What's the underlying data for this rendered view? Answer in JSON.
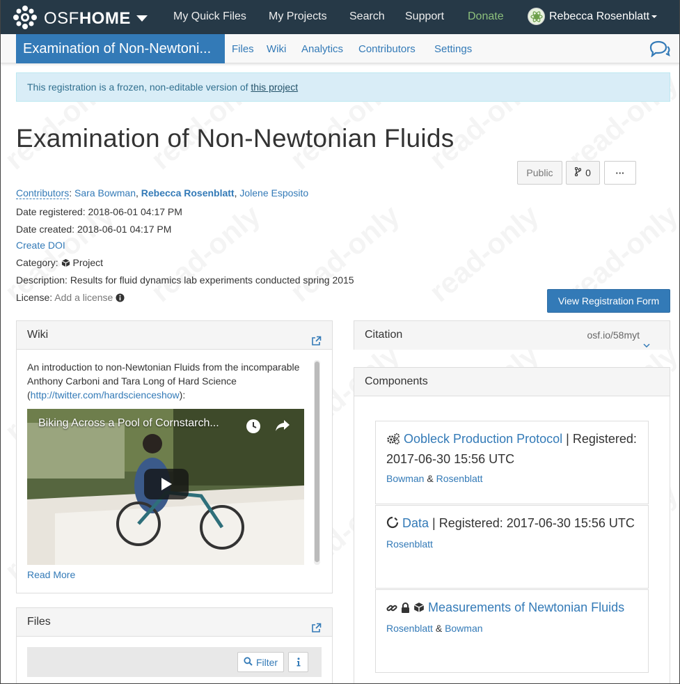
{
  "topnav": {
    "brand_pre": "OSF",
    "brand_post": "HOME",
    "items": [
      "My Quick Files",
      "My Projects",
      "Search",
      "Support",
      "Donate"
    ],
    "user_name": "Rebecca Rosenblatt"
  },
  "projnav": {
    "title": "Examination of Non-Newtoni...",
    "tabs": [
      "Files",
      "Wiki",
      "Analytics",
      "Contributors",
      "Settings"
    ]
  },
  "alert": {
    "text": "This registration is a frozen, non-editable version of ",
    "link": "this project"
  },
  "watermark_text": "read-only",
  "project": {
    "title": "Examination of Non-Newtonian Fluids",
    "visibility": "Public",
    "fork_count": "0",
    "more": "···",
    "contributors_label": "Contributors",
    "contributors": [
      "Sara Bowman",
      "Rebecca Rosenblatt",
      "Jolene Esposito"
    ],
    "date_registered_label": "Date registered:",
    "date_registered": "2018-06-01 04:17 PM",
    "date_created_label": "Date created:",
    "date_created": "2018-06-01 04:17 PM",
    "create_doi": "Create DOI",
    "category_label": "Category:",
    "category": "Project",
    "description_label": "Description:",
    "description": "Results for fluid dynamics lab experiments conducted spring 2015",
    "license_label": "License:",
    "license": "Add a license",
    "view_form_button": "View Registration Form"
  },
  "wiki": {
    "heading": "Wiki",
    "text_pre": "An introduction to non-Newtonian Fluids from the incomparable Anthony Carboni and Tara Long of Hard Science (",
    "link": "http://twitter.com/hardscienceshow",
    "text_post": "):",
    "video_title": "Biking Across a Pool of Cornstarch...",
    "read_more": "Read More"
  },
  "files": {
    "heading": "Files",
    "filter": "Filter"
  },
  "citation": {
    "heading": "Citation",
    "url": "osf.io/58myt"
  },
  "components": {
    "heading": "Components",
    "items": [
      {
        "title": "Oobleck Production Protocol",
        "sep": " | ",
        "registered": "Registered: 2017-06-30 15:56 UTC",
        "authors": [
          "Bowman",
          "Rosenblatt"
        ],
        "joiner": " & ",
        "icon": "cogs-icon"
      },
      {
        "title": "Data",
        "sep": " | ",
        "registered": "Registered: 2017-06-30 15:56 UTC",
        "authors": [
          "Rosenblatt"
        ],
        "joiner": "",
        "icon": "spinner-icon"
      },
      {
        "title": "Measurements of Newtonian Fluids",
        "sep": "",
        "registered": "",
        "authors": [
          "Rosenblatt",
          "Bowman"
        ],
        "joiner": " & ",
        "icon": "link-lock-cube-icon"
      }
    ]
  },
  "colors": {
    "nav_bg": "#263947",
    "primary": "#337ab7",
    "donate": "#8dc07c",
    "alert_bg": "#d9edf7"
  }
}
